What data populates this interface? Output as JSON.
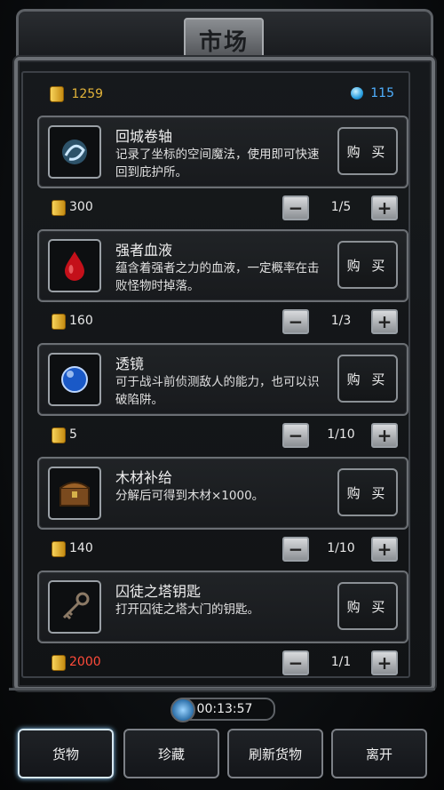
{
  "title": "市场",
  "currency": {
    "gold": "1259",
    "gems": "115"
  },
  "items": [
    {
      "name": "回城卷轴",
      "desc": "记录了坐标的空间魔法，使用即可快速回到庇护所。",
      "buy": "购 买",
      "price": "300",
      "qty": "1/5",
      "icon": "scroll-icon"
    },
    {
      "name": "强者血液",
      "desc": "蕴含着强者之力的血液，一定概率在击败怪物时掉落。",
      "buy": "购 买",
      "price": "160",
      "qty": "1/3",
      "icon": "blood-drop-icon"
    },
    {
      "name": "透镜",
      "desc": "可于战斗前侦测敌人的能力，也可以识破陷阱。",
      "buy": "购 买",
      "price": "5",
      "qty": "1/10",
      "icon": "lens-icon"
    },
    {
      "name": "木材补给",
      "desc": "分解后可得到木材×1000。",
      "buy": "购 买",
      "price": "140",
      "qty": "1/10",
      "icon": "wood-chest-icon"
    },
    {
      "name": "囚徒之塔钥匙",
      "desc": "打开囚徒之塔大门的钥匙。",
      "buy": "购 买",
      "price": "2000",
      "qty": "1/1",
      "icon": "key-icon"
    }
  ],
  "timer": "00:13:57",
  "tabs": [
    {
      "label": "货物"
    },
    {
      "label": "珍藏"
    },
    {
      "label": "刷新货物"
    },
    {
      "label": "离开"
    }
  ]
}
